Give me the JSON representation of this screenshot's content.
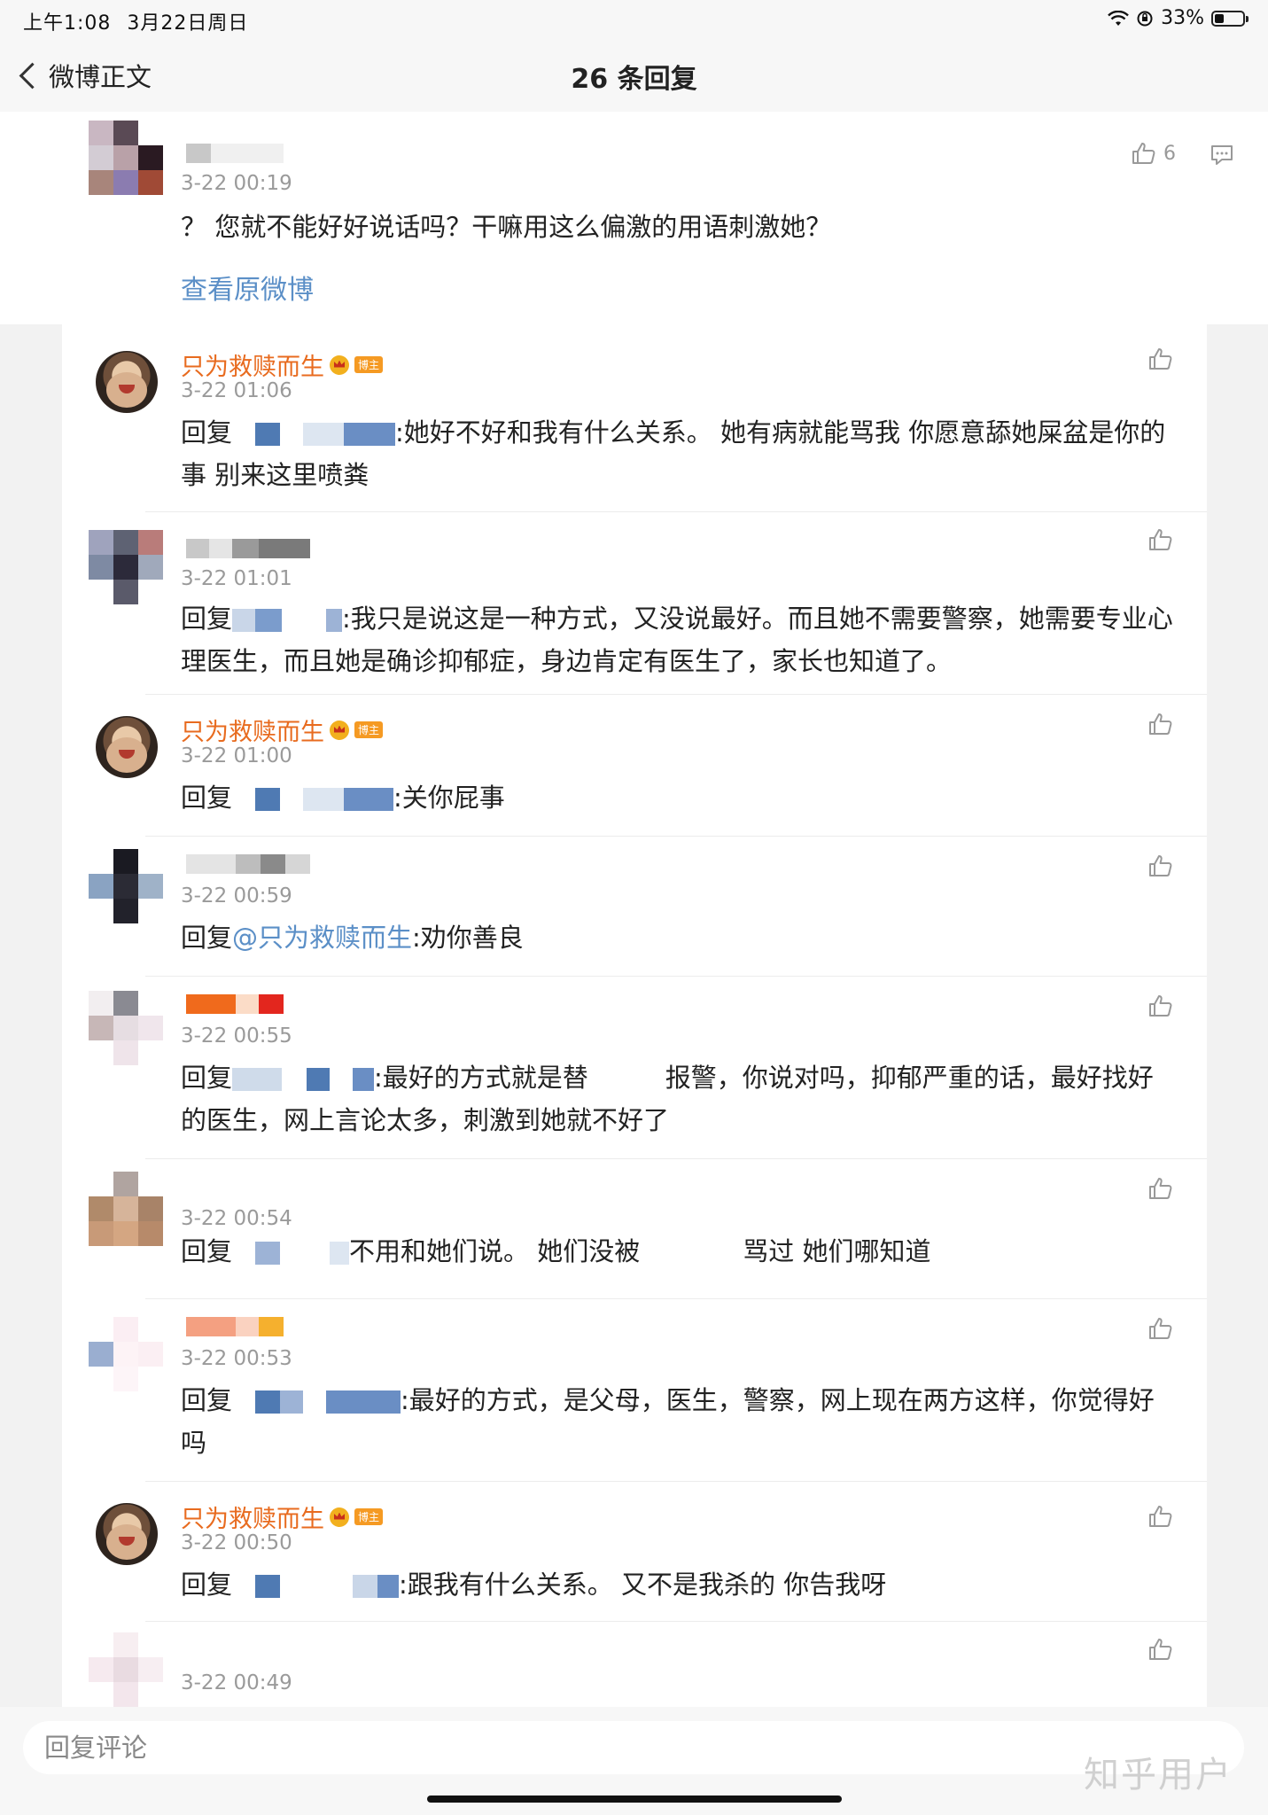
{
  "status_bar": {
    "time": "上午1:08",
    "date": "3月22日周日",
    "battery": "33%"
  },
  "header": {
    "back_label": "微博正文",
    "title": "26 条回复"
  },
  "root_comment": {
    "time": "3-22 00:19",
    "text": "？ 您就不能好好说话吗？干嘛用这么偏激的用语刺激她？",
    "like_count": "6",
    "view_original": "查看原微博"
  },
  "replies": [
    {
      "name": "只为救赎而生",
      "badge": "博主",
      "time": "3-22 01:06",
      "prefix": "回复",
      "text": ":她好不好和我有什么关系。 她有病就能骂我 你愿意舔她屎盆是你的事 别来这里喷粪"
    },
    {
      "name": "",
      "time": "3-22 01:01",
      "prefix": "回复",
      "text": ":我只是说这是一种方式，又没说最好。而且她不需要警察，她需要专业心理医生，而且她是确诊抑郁症，身边肯定有医生了，家长也知道了。"
    },
    {
      "name": "只为救赎而生",
      "badge": "博主",
      "time": "3-22 01:00",
      "prefix": "回复",
      "text": ":关你屁事"
    },
    {
      "name": "",
      "time": "3-22 00:59",
      "prefix": "回复",
      "mention": "@只为救赎而生",
      "text": ":劝你善良"
    },
    {
      "name": "",
      "time": "3-22 00:55",
      "prefix": "回复",
      "text": ":最好的方式就是替　　　报警，你说对吗，抑郁严重的话，最好找好的医生，网上言论太多，刺激到她就不好了"
    },
    {
      "name": "",
      "time": "3-22 00:54",
      "prefix": "回复",
      "text": "不用和她们说。 她们没被　　　　骂过 她们哪知道"
    },
    {
      "name": "",
      "time": "3-22 00:53",
      "prefix": "回复",
      "text": ":最好的方式，是父母，医生，警察，网上现在两方这样，你觉得好吗"
    },
    {
      "name": "只为救赎而生",
      "badge": "博主",
      "time": "3-22 00:50",
      "prefix": "回复",
      "text": ":跟我有什么关系。 又不是我杀的 你告我呀"
    },
    {
      "name": "",
      "time": "3-22 00:49",
      "prefix": "",
      "text": ""
    }
  ],
  "bottom": {
    "input_placeholder": "回复评论",
    "watermark": "知乎用户"
  },
  "colors": {
    "link": "#5b8fc7",
    "username": "#e86b1f",
    "time": "#9a9a9a"
  }
}
